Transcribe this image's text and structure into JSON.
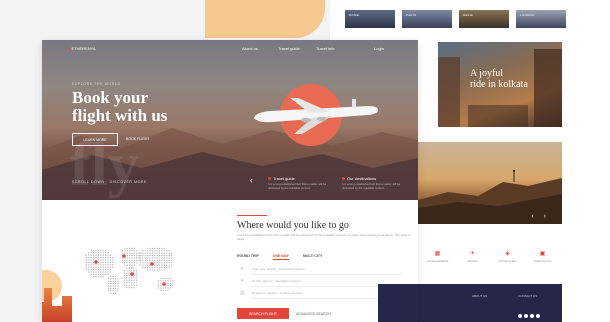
{
  "thumbs": [
    {
      "label": "ROME"
    },
    {
      "label": "PARIS"
    },
    {
      "label": "DELHI"
    },
    {
      "label": "LONDON"
    }
  ],
  "kolkata": {
    "title_line1": "A joyful",
    "title_line2": "ride in kolkata"
  },
  "cliff": {
    "prev": "‹",
    "next": "›"
  },
  "icon_row": [
    {
      "icon": "hotel-icon",
      "glyph": "▦",
      "label": "Accommodation"
    },
    {
      "icon": "flight-icon",
      "glyph": "✈",
      "label": "Airports"
    },
    {
      "icon": "guide-icon",
      "glyph": "◈",
      "label": "Tourist guide"
    },
    {
      "icon": "bus-icon",
      "glyph": "▣",
      "label": "Travel by bus"
    }
  ],
  "right_footer": {
    "col1": "ABOUT US",
    "col2": "CONTACT US"
  },
  "nav": {
    "brand_accent": "■",
    "brand": "ETHERENYA",
    "items": [
      "About us",
      "Travel guide",
      "Travel info",
      "Login"
    ]
  },
  "hero": {
    "subtitle": "EXPLORE THE WORLD",
    "title_line1": "Book your",
    "title_line2": "flight with us",
    "primary_button": "LEARN MORE",
    "secondary_link": "BOOK FLIGHT",
    "watermark": "fly",
    "bottom_line": "SCROLL DOWN · DISCOVER MORE",
    "features": [
      {
        "title": "Travel guide",
        "desc": "It is a long established fact that a reader will be distracted by the readable content."
      },
      {
        "title": "Our destinations",
        "desc": "It is a long established fact that a reader will be distracted by the readable content."
      }
    ],
    "prev": "‹"
  },
  "booking": {
    "title": "Where would you like to go",
    "desc": "It is a long established fact that a reader will be distracted by the readable content of a page when looking at its layout. The point of using.",
    "tabs": [
      "ROUND TRIP",
      "ONE WAY",
      "MULTI CITY"
    ],
    "fields": [
      {
        "icon": "plane-departure-icon",
        "glyph": "✈",
        "placeholder": "From (city, airport) · international airport"
      },
      {
        "icon": "plane-arrival-icon",
        "glyph": "✈",
        "placeholder": "To (city, airport) · international airport"
      },
      {
        "icon": "calendar-icon",
        "glyph": "▤",
        "placeholder": "Departure  ·  Return  ·  1 adult, economy"
      }
    ],
    "search_button": "SEARCH FLIGHT",
    "advanced_link": "ADVANCED SEARCH"
  },
  "colors": {
    "accent": "#e2463f",
    "footer": "#26264a"
  }
}
